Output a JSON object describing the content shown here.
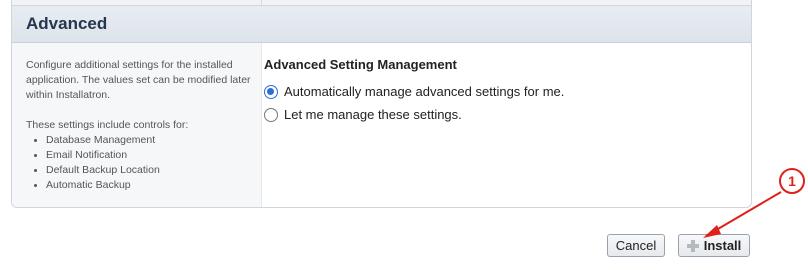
{
  "panel": {
    "title": "Advanced"
  },
  "sidebar": {
    "intro": "Configure additional settings for the installed application. The values set can be modified later within Installatron.",
    "controls_intro": "These settings include controls for:",
    "items": [
      {
        "label": "Database Management"
      },
      {
        "label": "Email Notification"
      },
      {
        "label": "Default Backup Location"
      },
      {
        "label": "Automatic Backup"
      }
    ]
  },
  "main": {
    "heading": "Advanced Setting Management",
    "options": [
      {
        "label": "Automatically manage advanced settings for me.",
        "selected": true
      },
      {
        "label": "Let me manage these settings.",
        "selected": false
      }
    ]
  },
  "actions": {
    "cancel_label": "Cancel",
    "install_label": "Install"
  },
  "annotation": {
    "marker": "1",
    "color": "#e0201b"
  }
}
